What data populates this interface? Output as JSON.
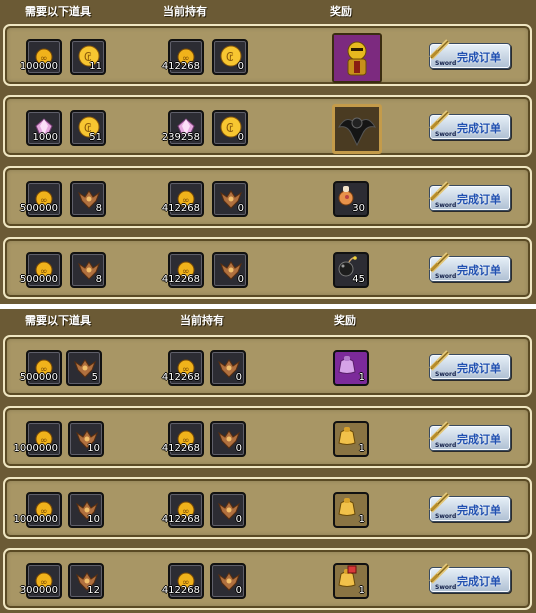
{
  "headers": {
    "required": "需要以下道具",
    "owned": "当前持有",
    "reward": "奖励"
  },
  "button_label": "完成订单",
  "button_sub": "Sword",
  "panels": [
    {
      "rows": [
        {
          "req1": "100000",
          "req2": "11",
          "own1": "412268",
          "own2": "0",
          "reward_count": "",
          "req1_icon": "gold-coin-icon",
          "req2_icon": "gold-token-icon",
          "reward_icon": "golden-knight-helmet-icon"
        },
        {
          "req1": "1000",
          "req2": "51",
          "own1": "239258",
          "own2": "0",
          "reward_count": "",
          "req1_icon": "pink-crystal-icon",
          "req2_icon": "gold-token-icon",
          "reward_icon": "dark-winged-creature-icon"
        },
        {
          "req1": "500000",
          "req2": "8",
          "own1": "412268",
          "own2": "0",
          "reward_count": "30",
          "req1_icon": "gold-coin-icon",
          "req2_icon": "bronze-bat-emblem-icon",
          "reward_icon": "meat-bag-icon"
        },
        {
          "req1": "500000",
          "req2": "8",
          "own1": "412268",
          "own2": "0",
          "reward_count": "45",
          "req1_icon": "gold-coin-icon",
          "req2_icon": "bronze-bat-emblem-icon",
          "reward_icon": "bomb-icon"
        }
      ]
    },
    {
      "rows": [
        {
          "req1": "500000",
          "req2": "5",
          "own1": "412268",
          "own2": "0",
          "reward_count": "1",
          "req1_icon": "gold-coin-icon",
          "req2_icon": "bronze-bat-emblem-icon",
          "reward_icon": "purple-pouch-icon"
        },
        {
          "req1": "1000000",
          "req2": "10",
          "own1": "412268",
          "own2": "0",
          "reward_count": "1",
          "req1_icon": "gold-coin-icon",
          "req2_icon": "bronze-bat-emblem-icon",
          "reward_icon": "gold-pouch-icon"
        },
        {
          "req1": "1000000",
          "req2": "10",
          "own1": "412268",
          "own2": "0",
          "reward_count": "1",
          "req1_icon": "gold-coin-icon",
          "req2_icon": "bronze-bat-emblem-icon",
          "reward_icon": "gold-pouch-icon"
        },
        {
          "req1": "300000",
          "req2": "12",
          "own1": "412268",
          "own2": "0",
          "reward_count": "1",
          "req1_icon": "gold-coin-icon",
          "req2_icon": "bronze-bat-emblem-icon",
          "reward_icon": "gold-pouch-red-tag-icon"
        }
      ]
    }
  ],
  "colors": {
    "panel_bg": "#6b5a35",
    "row_bg": "#a89665",
    "slot_bg": "#2c2c33",
    "button_text": "#1f4fb0"
  }
}
